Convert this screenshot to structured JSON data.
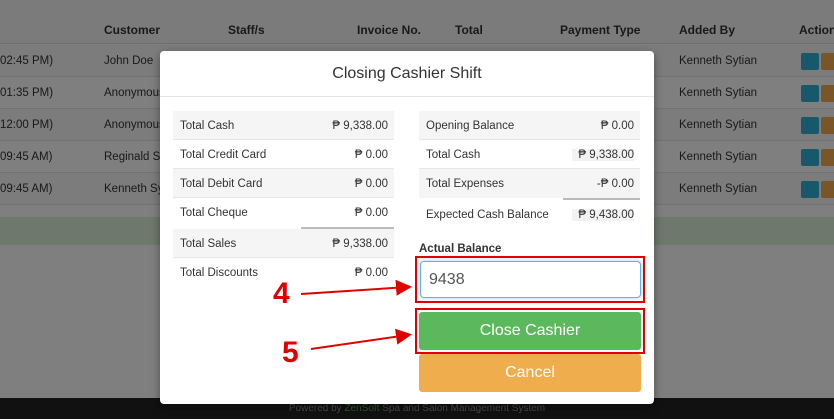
{
  "background_table": {
    "headers": [
      "Customer",
      "Staff/s",
      "Invoice No.",
      "Total",
      "Payment Type",
      "Added By",
      "Actions"
    ],
    "rows": [
      {
        "time": "02:45 PM)",
        "customer": "John Doe",
        "added_by": "Kenneth Sytian"
      },
      {
        "time": "01:35 PM)",
        "customer": "Anonymous",
        "added_by": "Kenneth Sytian"
      },
      {
        "time": "12:00 PM)",
        "customer": "Anonymous",
        "added_by": "Kenneth Sytian"
      },
      {
        "time": "09:45 AM)",
        "customer": "Reginald Sa",
        "added_by": "Kenneth Sytian"
      },
      {
        "time": "09:45 AM)",
        "customer": "Kenneth Sy",
        "added_by": "Kenneth Sytian"
      }
    ],
    "action_icons": [
      "eye-icon",
      "pencil-icon"
    ]
  },
  "footer": {
    "prefix": "Powered by ",
    "brand": "ZenSoft",
    "suffix": " Spa and Salon Management System"
  },
  "modal": {
    "title": "Closing Cashier Shift",
    "left_summary": [
      {
        "label": "Total Cash",
        "value": "₱ 9,338.00"
      },
      {
        "label": "Total Credit Card",
        "value": "₱ 0.00"
      },
      {
        "label": "Total Debit Card",
        "value": "₱ 0.00"
      },
      {
        "label": "Total Cheque",
        "value": "₱ 0.00"
      },
      {
        "label": "Total Sales",
        "value": "₱ 9,338.00"
      },
      {
        "label": "Total Discounts",
        "value": "₱ 0.00"
      }
    ],
    "right_summary": [
      {
        "label": "Opening Balance",
        "value": "₱ 0.00"
      },
      {
        "label": "Total Cash",
        "value": "₱ 9,338.00"
      },
      {
        "label": "Total Expenses",
        "value": "-₱ 0.00"
      },
      {
        "label": "Expected Cash Balance",
        "value": "₱ 9,438.00"
      }
    ],
    "actual_balance_label": "Actual Balance",
    "actual_balance_value": "9438",
    "close_button": "Close Cashier",
    "cancel_button": "Cancel"
  },
  "annotations": {
    "step_4": "4",
    "step_5": "5",
    "color": "#e00000"
  }
}
